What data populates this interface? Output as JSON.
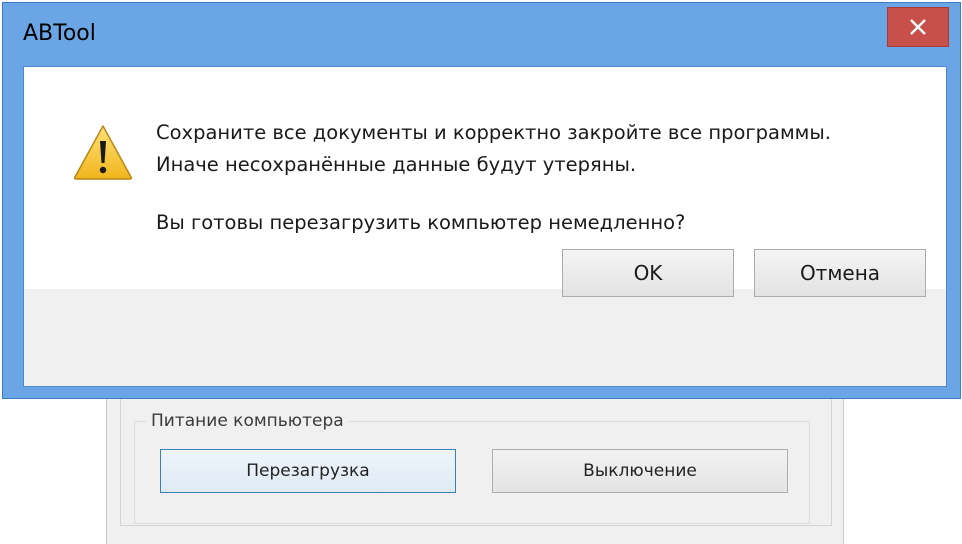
{
  "background_window": {
    "group_label": "Питание компьютера",
    "restart_label": "Перезагрузка",
    "shutdown_label": "Выключение"
  },
  "dialog": {
    "title": "ABTool",
    "icon": "warning-icon",
    "close_icon": "close-icon",
    "message_line1": "Сохраните все документы и корректно закройте все программы.",
    "message_line2": "Иначе несохранённые данные будут утеряны.",
    "question": "Вы готовы перезагрузить компьютер немедленно?",
    "ok_label": "OK",
    "cancel_label": "Отмена"
  },
  "colors": {
    "title_bar": "#6aa6e6",
    "close_button": "#c7504b",
    "warning_fill": "#f5c623"
  }
}
